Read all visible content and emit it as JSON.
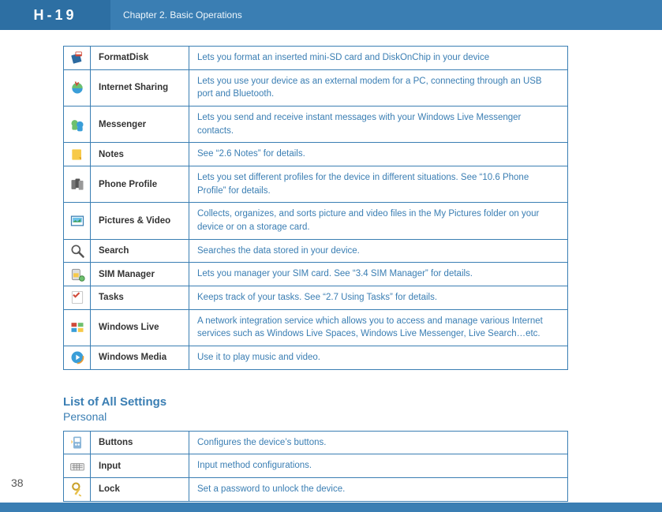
{
  "logo": "H-19",
  "chapter": "Chapter 2. Basic Operations",
  "page_number": "38",
  "programs": [
    {
      "icon": "formatdisk-icon",
      "name": "FormatDisk",
      "desc": "Lets you format an inserted mini-SD card and DiskOnChip in your device"
    },
    {
      "icon": "internet-sharing-icon",
      "name": "Internet Sharing",
      "desc": "Lets you use your device as an external modem for a PC, connecting through an USB port and Bluetooth."
    },
    {
      "icon": "messenger-icon",
      "name": "Messenger",
      "desc": "Lets you send and receive instant messages with your Windows Live Messenger contacts."
    },
    {
      "icon": "notes-icon",
      "name": "Notes",
      "desc": "See “2.6 Notes” for details."
    },
    {
      "icon": "phone-profile-icon",
      "name": "Phone Profile",
      "desc": "Lets you set different profiles for the device in different situations. See “10.6 Phone Profile” for details."
    },
    {
      "icon": "pictures-video-icon",
      "name": "Pictures & Video",
      "desc": "Collects, organizes, and sorts picture and video files in the My Pictures folder on your device or on a storage card."
    },
    {
      "icon": "search-icon",
      "name": "Search",
      "desc": "Searches the data stored in your device."
    },
    {
      "icon": "sim-manager-icon",
      "name": "SIM Manager",
      "desc": "Lets you manager your SIM card. See “3.4 SIM Manager” for details."
    },
    {
      "icon": "tasks-icon",
      "name": "Tasks",
      "desc": "Keeps track of your tasks. See “2.7 Using Tasks” for details."
    },
    {
      "icon": "windows-live-icon",
      "name": "Windows Live",
      "desc": "A network integration service which allows you to access and manage various Internet services such as Windows Live Spaces, Windows Live Messenger, Live Search…etc."
    },
    {
      "icon": "windows-media-icon",
      "name": "Windows Media",
      "desc": "Use it to play music and video."
    }
  ],
  "settings_heading": "List of All Settings",
  "settings_sub": "Personal",
  "settings": [
    {
      "icon": "buttons-icon",
      "name": "Buttons",
      "desc": "Configures the device’s buttons."
    },
    {
      "icon": "input-icon",
      "name": "Input",
      "desc": "Input method configurations."
    },
    {
      "icon": "lock-icon",
      "name": "Lock",
      "desc": "Set a password to unlock the device."
    }
  ]
}
